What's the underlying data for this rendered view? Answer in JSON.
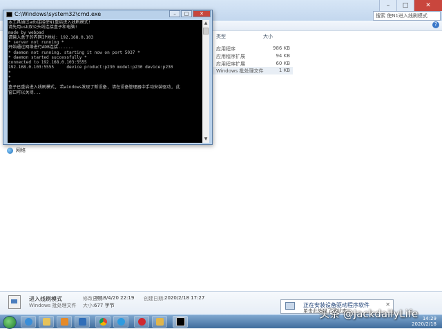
{
  "explorer": {
    "search_placeholder": "搜索 使N1进入线刷模式",
    "columns": {
      "type": "类型",
      "size": "大小"
    },
    "files": [
      {
        "type": "应用程序",
        "size": "986 KB"
      },
      {
        "type": "应用程序扩展",
        "size": "94 KB"
      },
      {
        "type": "应用程序扩展",
        "size": "60 KB"
      },
      {
        "type": "Windows 批处理文件",
        "size": "1 KB"
      }
    ],
    "nav_network": "网络",
    "details": {
      "name": "进入线刷模式",
      "type": "Windows 批处理文件",
      "modified_label": "修改日期:",
      "modified_value": "2018/4/20 22:19",
      "size_label": "大小:",
      "size_value": "677 字节",
      "created_label": "创建日期:",
      "created_value": "2020/2/18 17:27"
    }
  },
  "cmd": {
    "title": "C:\\Windows\\system32\\cmd.exe",
    "lines": [
      "本工具通过adb连接使N1重启进入线刷模式!",
      "请先用usb双公头线连接盒子和电脑!",
      "made by webpad",
      "",
      "请输入盒子的内网IP地址: 192.168.0.103",
      "* server not running *",
      "开始通过网络进行ADB连接......",
      "* daemon not running. starting it now on port 5037 *",
      "* daemon started successfully *",
      "connected to 192.168.0.103:5555",
      "192.168.0.103:5555     device product:p230 model:p230 device:p230",
      "",
      "*",
      "*",
      "*",
      "盒子已重启进入线刷模式, 若windows发现了新设备, 请在设备管理器中手动安装驱动, 此",
      "窗口可以关闭..."
    ]
  },
  "notification": {
    "line1": "正在安装设备驱动程序软件",
    "line2": "单击此处以了解状态"
  },
  "tray": {
    "time": "14:29",
    "date": "2020/2/18"
  },
  "watermark": "头条 @JackdailyLife"
}
